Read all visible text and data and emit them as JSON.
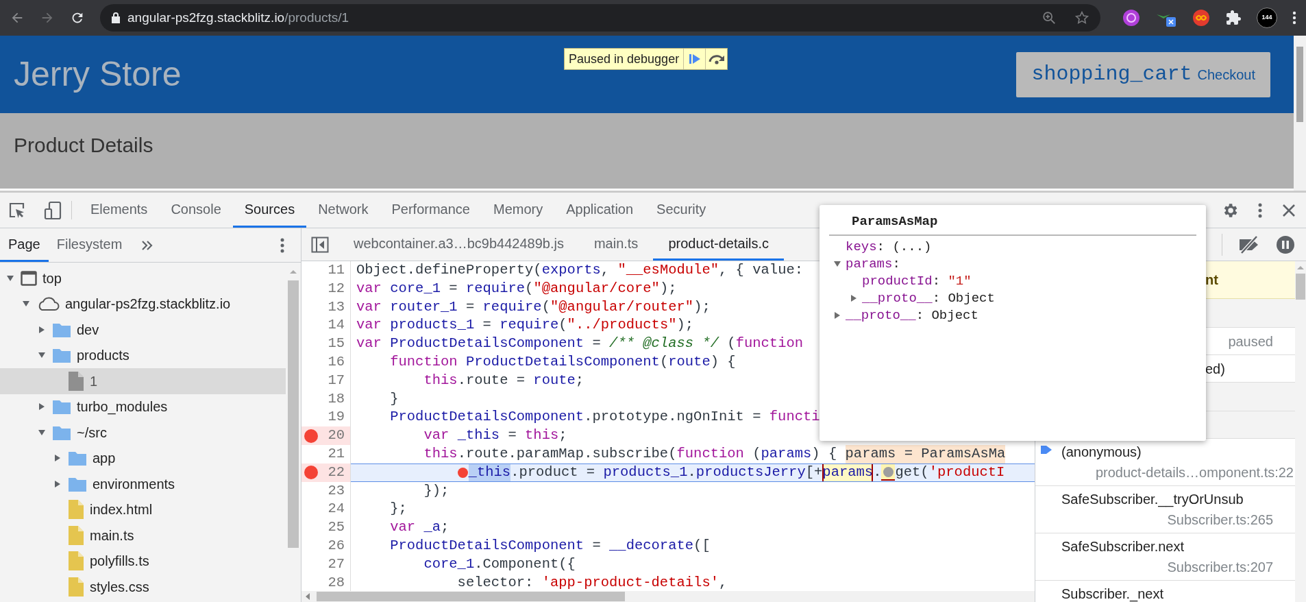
{
  "browser": {
    "url_host": "angular-ps2fzg.stackblitz.io",
    "url_path": "/products/1",
    "avatar_badge": "144"
  },
  "page": {
    "title": "Jerry Store",
    "debugger_banner": "Paused in debugger",
    "cart_icon_text": "shopping_cart",
    "checkout_label": "Checkout",
    "section_title": "Product Details"
  },
  "devtools_tabs": [
    {
      "label": "Elements",
      "selected": false
    },
    {
      "label": "Console",
      "selected": false
    },
    {
      "label": "Sources",
      "selected": true
    },
    {
      "label": "Network",
      "selected": false
    },
    {
      "label": "Performance",
      "selected": false
    },
    {
      "label": "Memory",
      "selected": false
    },
    {
      "label": "Application",
      "selected": false
    },
    {
      "label": "Security",
      "selected": false
    }
  ],
  "navigator_tabs": [
    {
      "label": "Page",
      "selected": true
    },
    {
      "label": "Filesystem",
      "selected": false
    }
  ],
  "tree": [
    {
      "label": "top",
      "kind": "frame",
      "expanded": true,
      "selected": false,
      "children": [
        {
          "label": "angular-ps2fzg.stackblitz.io",
          "kind": "domain",
          "expanded": true,
          "selected": false,
          "children": [
            {
              "label": "dev",
              "kind": "folder",
              "expanded": false,
              "selected": false
            },
            {
              "label": "products",
              "kind": "folder",
              "expanded": true,
              "selected": false,
              "children": [
                {
                  "label": "1",
                  "kind": "file",
                  "color": "#8f8f8f",
                  "selected": true
                }
              ]
            },
            {
              "label": "turbo_modules",
              "kind": "folder",
              "expanded": false,
              "selected": false
            },
            {
              "label": "~/src",
              "kind": "folder",
              "expanded": true,
              "selected": false,
              "children": [
                {
                  "label": "app",
                  "kind": "folder",
                  "expanded": false,
                  "selected": false
                },
                {
                  "label": "environments",
                  "kind": "folder",
                  "expanded": false,
                  "selected": false
                },
                {
                  "label": "index.html",
                  "kind": "file",
                  "color": "#e5c54f",
                  "selected": false
                },
                {
                  "label": "main.ts",
                  "kind": "file",
                  "color": "#e5c54f",
                  "selected": false
                },
                {
                  "label": "polyfills.ts",
                  "kind": "file",
                  "color": "#e5c54f",
                  "selected": false
                },
                {
                  "label": "styles.css",
                  "kind": "file",
                  "color": "#e5c54f",
                  "selected": false
                }
              ]
            }
          ]
        }
      ]
    }
  ],
  "editor_tabs": [
    {
      "label": "webcontainer.a3…bc9b442489b.js",
      "selected": false
    },
    {
      "label": "main.ts",
      "selected": false
    },
    {
      "label": "product-details.c",
      "selected": true
    }
  ],
  "code": [
    {
      "number": "11",
      "kind": "root",
      "breakpoint": false,
      "current": false,
      "tokens": [
        {
          "kind": "plain",
          "text": "Object.defineProperty("
        },
        {
          "kind": "name",
          "text": "exports"
        },
        {
          "kind": "plain",
          "text": ", "
        },
        {
          "kind": "string",
          "text": "\"__esModule\""
        },
        {
          "kind": "plain",
          "text": ", { value:"
        }
      ]
    },
    {
      "number": "12",
      "kind": "root",
      "breakpoint": false,
      "current": false,
      "tokens": [
        {
          "kind": "keyword",
          "text": "var "
        },
        {
          "kind": "name",
          "text": "core_1"
        },
        {
          "kind": "plain",
          "text": " = "
        },
        {
          "kind": "name",
          "text": "require"
        },
        {
          "kind": "plain",
          "text": "("
        },
        {
          "kind": "string",
          "text": "\"@angular/core\""
        },
        {
          "kind": "plain",
          "text": ");"
        }
      ]
    },
    {
      "number": "13",
      "kind": "root",
      "breakpoint": false,
      "current": false,
      "tokens": [
        {
          "kind": "keyword",
          "text": "var "
        },
        {
          "kind": "name",
          "text": "router_1"
        },
        {
          "kind": "plain",
          "text": " = "
        },
        {
          "kind": "name",
          "text": "require"
        },
        {
          "kind": "plain",
          "text": "("
        },
        {
          "kind": "string",
          "text": "\"@angular/router\""
        },
        {
          "kind": "plain",
          "text": ");"
        }
      ]
    },
    {
      "number": "14",
      "kind": "root",
      "breakpoint": false,
      "current": false,
      "tokens": [
        {
          "kind": "keyword",
          "text": "var "
        },
        {
          "kind": "name",
          "text": "products_1"
        },
        {
          "kind": "plain",
          "text": " = "
        },
        {
          "kind": "name",
          "text": "require"
        },
        {
          "kind": "plain",
          "text": "("
        },
        {
          "kind": "string",
          "text": "\"../products\""
        },
        {
          "kind": "plain",
          "text": ");"
        }
      ]
    },
    {
      "number": "15",
      "kind": "root",
      "breakpoint": false,
      "current": false,
      "tokens": [
        {
          "kind": "keyword",
          "text": "var "
        },
        {
          "kind": "name",
          "text": "ProductDetailsComponent"
        },
        {
          "kind": "plain",
          "text": " = "
        },
        {
          "kind": "comment",
          "text": "/** @class */"
        },
        {
          "kind": "plain",
          "text": " ("
        },
        {
          "kind": "keyword",
          "text": "function"
        }
      ]
    },
    {
      "number": "16",
      "kind": "inner",
      "breakpoint": false,
      "current": false,
      "tokens": [
        {
          "kind": "keyword",
          "text": "function "
        },
        {
          "kind": "name",
          "text": "ProductDetailsComponent"
        },
        {
          "kind": "plain",
          "text": "("
        },
        {
          "kind": "name",
          "text": "route"
        },
        {
          "kind": "plain",
          "text": ") {"
        }
      ]
    },
    {
      "number": "17",
      "kind": "deep",
      "breakpoint": false,
      "current": false,
      "tokens": [
        {
          "kind": "keyword",
          "text": "this"
        },
        {
          "kind": "plain",
          "text": ".route = "
        },
        {
          "kind": "name",
          "text": "route"
        },
        {
          "kind": "plain",
          "text": ";"
        }
      ]
    },
    {
      "number": "18",
      "kind": "inner",
      "breakpoint": false,
      "current": false,
      "tokens": [
        {
          "kind": "plain",
          "text": "}"
        }
      ]
    },
    {
      "number": "19",
      "kind": "inner",
      "breakpoint": false,
      "current": false,
      "tokens": [
        {
          "kind": "name",
          "text": "ProductDetailsComponent"
        },
        {
          "kind": "plain",
          "text": ".prototype.ngOnInit = "
        },
        {
          "kind": "keyword",
          "text": "functi"
        }
      ]
    },
    {
      "number": "20",
      "kind": "deep",
      "breakpoint": true,
      "current": false,
      "tokens": [
        {
          "kind": "keyword",
          "text": "var "
        },
        {
          "kind": "name",
          "text": "_this"
        },
        {
          "kind": "plain",
          "text": " = "
        },
        {
          "kind": "keyword",
          "text": "this"
        },
        {
          "kind": "plain",
          "text": ";"
        }
      ]
    },
    {
      "number": "21",
      "kind": "deep",
      "breakpoint": false,
      "current": false,
      "tokens": [
        {
          "kind": "keyword",
          "text": "this"
        },
        {
          "kind": "plain",
          "text": ".route.paramMap.subscribe("
        },
        {
          "kind": "keyword",
          "text": "function"
        },
        {
          "kind": "plain",
          "text": " ("
        },
        {
          "kind": "name",
          "text": "params"
        },
        {
          "kind": "plain",
          "text": ") { "
        },
        {
          "kind": "inline-value",
          "text": "params = ParamsAsMa"
        }
      ]
    },
    {
      "number": "22",
      "kind": "deeper",
      "breakpoint": true,
      "current": true,
      "tokens": [
        {
          "kind": "inline-breakpoint",
          "enabled": true
        },
        {
          "kind": "selection",
          "text": "_this"
        },
        {
          "kind": "plain",
          "text": ".product = "
        },
        {
          "kind": "name",
          "text": "products_1"
        },
        {
          "kind": "plain",
          "text": "."
        },
        {
          "kind": "name",
          "text": "productsJerry"
        },
        {
          "kind": "plain",
          "text": "[+"
        },
        {
          "kind": "inspected",
          "text": "params"
        },
        {
          "kind": "plain",
          "text": "."
        },
        {
          "kind": "inline-breakpoint",
          "enabled": false
        },
        {
          "kind": "plain",
          "text": "get("
        },
        {
          "kind": "string",
          "text": "'productI"
        }
      ]
    },
    {
      "number": "23",
      "kind": "deep",
      "breakpoint": false,
      "current": false,
      "tokens": [
        {
          "kind": "plain",
          "text": "});"
        }
      ]
    },
    {
      "number": "24",
      "kind": "inner",
      "breakpoint": false,
      "current": false,
      "tokens": [
        {
          "kind": "plain",
          "text": "};"
        }
      ]
    },
    {
      "number": "25",
      "kind": "inner",
      "breakpoint": false,
      "current": false,
      "tokens": [
        {
          "kind": "keyword",
          "text": "var "
        },
        {
          "kind": "name",
          "text": "_a"
        },
        {
          "kind": "plain",
          "text": ";"
        }
      ]
    },
    {
      "number": "26",
      "kind": "inner",
      "breakpoint": false,
      "current": false,
      "tokens": [
        {
          "kind": "name",
          "text": "ProductDetailsComponent"
        },
        {
          "kind": "plain",
          "text": " = "
        },
        {
          "kind": "name",
          "text": "__decorate"
        },
        {
          "kind": "plain",
          "text": "(["
        }
      ]
    },
    {
      "number": "27",
      "kind": "deep",
      "breakpoint": false,
      "current": false,
      "tokens": [
        {
          "kind": "name",
          "text": "core_1"
        },
        {
          "kind": "plain",
          "text": ".Component({"
        }
      ]
    },
    {
      "number": "28",
      "kind": "deeper",
      "breakpoint": false,
      "current": false,
      "tokens": [
        {
          "kind": "plain",
          "text": "selector: "
        },
        {
          "kind": "string",
          "text": "'app-product-details'"
        },
        {
          "kind": "plain",
          "text": ","
        }
      ]
    }
  ],
  "popover": {
    "title": "ParamsAsMap",
    "properties": [
      {
        "name": "keys",
        "kind": "value",
        "separator": ": ",
        "value": {
          "kind": "plain",
          "text": "(...)"
        }
      },
      {
        "name": "params",
        "kind": "group",
        "expanded": true,
        "separator": ":",
        "children": [
          {
            "name": "productId",
            "kind": "value",
            "separator": ": ",
            "value": {
              "kind": "string",
              "text": "\"1\""
            }
          },
          {
            "name": "__proto__",
            "kind": "group",
            "expanded": false,
            "separator": ": ",
            "value": {
              "kind": "plain",
              "text": "Object"
            }
          }
        ]
      },
      {
        "name": "__proto__",
        "kind": "group",
        "expanded": false,
        "separator": ": ",
        "value": {
          "kind": "plain",
          "text": "Object"
        }
      }
    ]
  },
  "debugger": {
    "paused_banner": "nt",
    "rows": [
      "paused",
      "ed)"
    ],
    "call_stack": [
      {
        "name": "(anonymous)",
        "location": "product-details…omponent.ts:22",
        "selected": true
      },
      {
        "name": "SafeSubscriber.__tryOrUnsub",
        "location": "Subscriber.ts:265",
        "selected": false
      },
      {
        "name": "SafeSubscriber.next",
        "location": "Subscriber.ts:207",
        "selected": false
      },
      {
        "name": "Subscriber._next",
        "selected": false
      }
    ]
  }
}
